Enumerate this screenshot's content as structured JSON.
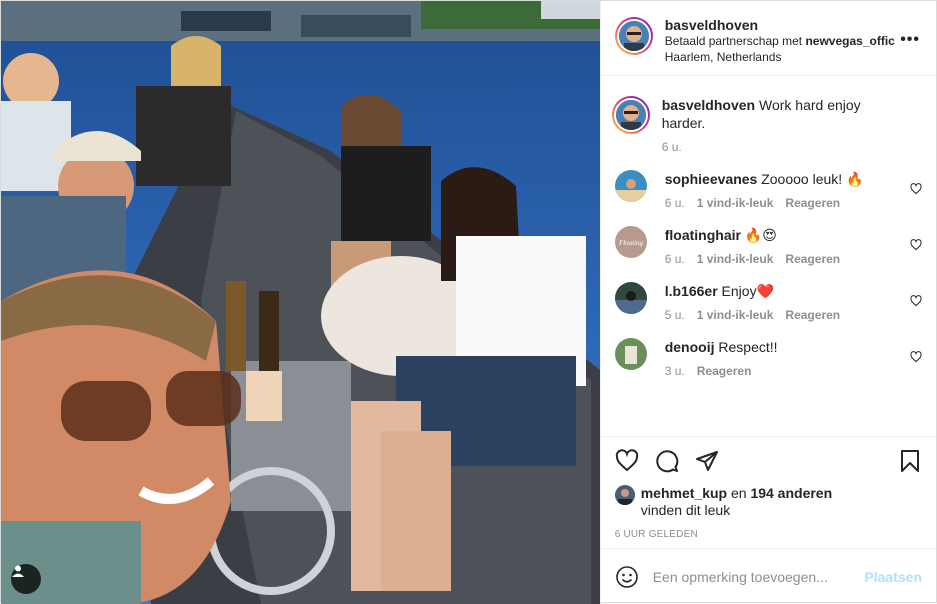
{
  "post": {
    "author": "basveldhoven",
    "sponsor_prefix": "Betaald partnerschap met ",
    "sponsor_name": "newvegas_offic",
    "location": "Haarlem, Netherlands",
    "more_glyph": "•••"
  },
  "caption": {
    "user": "basveldhoven",
    "text": "Work hard enjoy harder.",
    "time": "6 u."
  },
  "comments": [
    {
      "user": "sophieevanes",
      "text": "Zooooo leuk! 🔥",
      "time": "6 u.",
      "likes": "1 vind-ik-leuk",
      "reply": "Reageren",
      "avatar_color": "#3a8fc2"
    },
    {
      "user": "floatinghair",
      "text": "🔥😍",
      "time": "6 u.",
      "likes": "1 vind-ik-leuk",
      "reply": "Reageren",
      "avatar_color": "#b79a8d"
    },
    {
      "user": "l.b166er",
      "text": "Enjoy❤️",
      "time": "5 u.",
      "likes": "1 vind-ik-leuk",
      "reply": "Reageren",
      "avatar_color": "#2f4a3a"
    },
    {
      "user": "denooij",
      "text": "Respect!!",
      "time": "3 u.",
      "likes": "",
      "reply": "Reageren",
      "avatar_color": "#6b8f5a"
    }
  ],
  "likes": {
    "user": "mehmet_kup",
    "middle": " en ",
    "count": "194 anderen",
    "suffix": "vinden dit leuk"
  },
  "timestamp": "6 UUR GELEDEN",
  "add_comment": {
    "placeholder": "Een opmerking toevoegen...",
    "post_label": "Plaatsen"
  },
  "icons": {
    "like": "heart-icon",
    "comment": "comment-icon",
    "share": "share-icon",
    "save": "bookmark-icon",
    "emoji": "emoji-icon",
    "tag": "user-tag-icon"
  },
  "colors": {
    "link_disabled": "#b2dffc",
    "muted": "#8e8e8e",
    "text": "#262626"
  }
}
